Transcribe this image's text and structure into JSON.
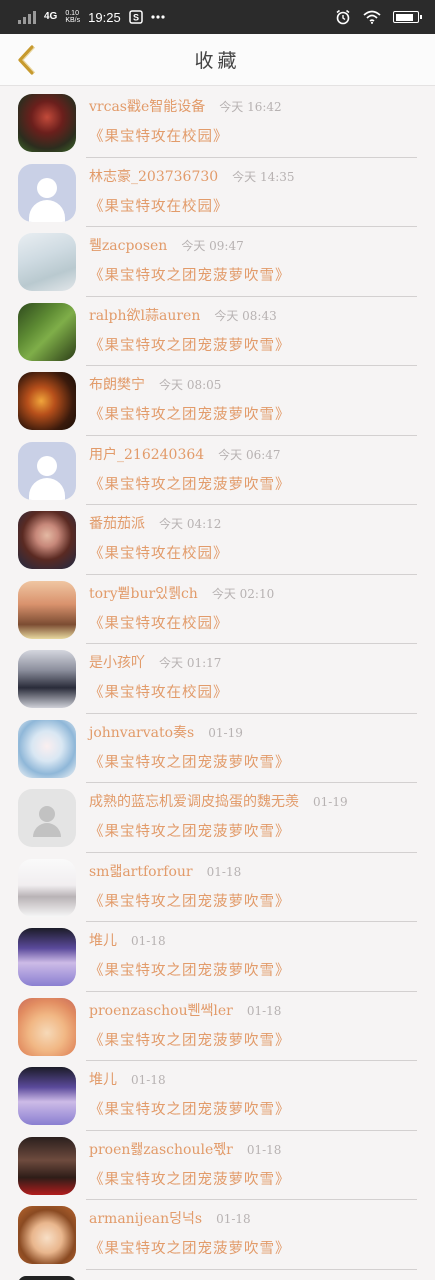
{
  "status_bar": {
    "network": "4G",
    "data_speed_value": "0.10",
    "data_speed_unit": "KB/s",
    "time": "19:25",
    "icons": [
      "signal-icon",
      "sim-app-icon",
      "more-icon",
      "alarm-icon",
      "wifi-icon",
      "battery-icon"
    ],
    "battery_level": 0.85
  },
  "header": {
    "title": "收藏",
    "back_icon": "chevron-left-icon"
  },
  "colors": {
    "accent": "#e29b6a",
    "time_text": "#b7b2b2",
    "back_arrow": "#c79a2e"
  },
  "items": [
    {
      "name": "vrcas戳e智能设备",
      "time": "今天 16:42",
      "title": "《果宝特攻在校园》",
      "avatar": "dark-red-character"
    },
    {
      "name": "林志豪_203736730",
      "time": "今天 14:35",
      "title": "《果宝特攻在校园》",
      "avatar": "default-placeholder"
    },
    {
      "name": "뤨zacposen",
      "time": "今天 09:47",
      "title": "《果宝特攻之团宠菠萝吹雪》",
      "avatar": "blurred-light"
    },
    {
      "name": "ralph欲l蒜auren",
      "time": "今天 08:43",
      "title": "《果宝特攻之团宠菠萝吹雪》",
      "avatar": "green-plants"
    },
    {
      "name": "布朗樊宁",
      "time": "今天 08:05",
      "title": "《果宝特攻之团宠菠萝吹雪》",
      "avatar": "orange-fire"
    },
    {
      "name": "用户_216240364",
      "time": "今天 06:47",
      "title": "《果宝特攻之团宠菠萝吹雪》",
      "avatar": "default-placeholder"
    },
    {
      "name": "番茄茄派",
      "time": "今天 04:12",
      "title": "《果宝特攻在校园》",
      "avatar": "woman-portrait"
    },
    {
      "name": "tory쀁bur있뤩ch",
      "time": "今天 02:10",
      "title": "《果宝特攻在校园》",
      "avatar": "girl-photo"
    },
    {
      "name": "是小孩吖",
      "time": "今天 01:17",
      "title": "《果宝特攻在校园》",
      "avatar": "person-dark"
    },
    {
      "name": "johnvarvato奏s",
      "time": "01-19",
      "title": "《果宝特攻之团宠菠萝吹雪》",
      "avatar": "anime-girl"
    },
    {
      "name": "成熟的蓝忘机爱调皮捣蛋的魏无羡",
      "time": "01-19",
      "title": "《果宝特攻之团宠菠萝吹雪》",
      "avatar": "grey-placeholder"
    },
    {
      "name": "sm랣artforfour",
      "time": "01-18",
      "title": "《果宝特攻之团宠菠萝吹雪》",
      "avatar": "cartoon-cat"
    },
    {
      "name": "堆儿",
      "time": "01-18",
      "title": "《果宝特攻之团宠菠萝吹雪》",
      "avatar": "purple-cat"
    },
    {
      "name": "proenzaschou쀈쌕ler",
      "time": "01-18",
      "title": "《果宝特攻之团宠菠萝吹雪》",
      "avatar": "origami-sunset"
    },
    {
      "name": "堆儿",
      "time": "01-18",
      "title": "《果宝特攻之团宠菠萝吹雪》",
      "avatar": "purple-cat"
    },
    {
      "name": "proen뢣zaschoule쩫r",
      "time": "01-18",
      "title": "《果宝特攻之团宠菠萝吹雪》",
      "avatar": "dark-woman-red"
    },
    {
      "name": "armanijean덩넉s",
      "time": "01-18",
      "title": "《果宝特攻之团宠菠萝吹雪》",
      "avatar": "anime-boy"
    }
  ]
}
